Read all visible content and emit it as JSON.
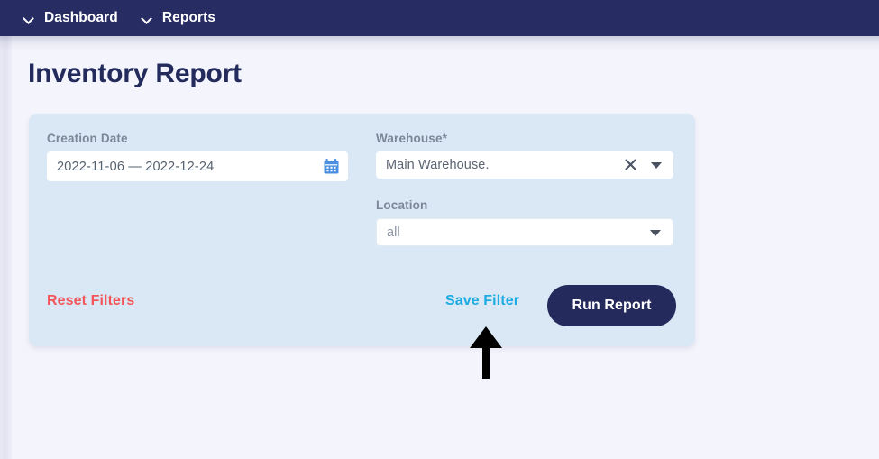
{
  "navbar": {
    "items": [
      {
        "icon": "chevron-down-icon",
        "label": "Dashboard"
      },
      {
        "icon": "chevron-down-icon",
        "label": "Reports"
      }
    ]
  },
  "page": {
    "title": "Inventory Report"
  },
  "filters": {
    "creation_date": {
      "label": "Creation Date",
      "value": "2022-11-06 — 2022-12-24",
      "icon": "calendar-icon"
    },
    "warehouse": {
      "label": "Warehouse*",
      "value": "Main Warehouse.",
      "clear_icon": "close-x-icon",
      "caret_icon": "caret-down-icon"
    },
    "location": {
      "label": "Location",
      "value": "all",
      "caret_icon": "caret-down-icon"
    }
  },
  "actions": {
    "reset_filters": "Reset Filters",
    "save_filter": "Save Filter",
    "run_report": "Run Report"
  },
  "annotation": {
    "arrow": "up-arrow-annotation"
  },
  "colors": {
    "navbar_bg": "#272c63",
    "page_bg": "#f4f4fc",
    "card_bg": "#d9e8f4",
    "title_text": "#232a5c",
    "label_text": "#7d8699",
    "reset_link": "#f4555a",
    "save_link": "#1cabe2",
    "primary_button": "#242a5b",
    "calendar_icon": "#4a90e2"
  }
}
